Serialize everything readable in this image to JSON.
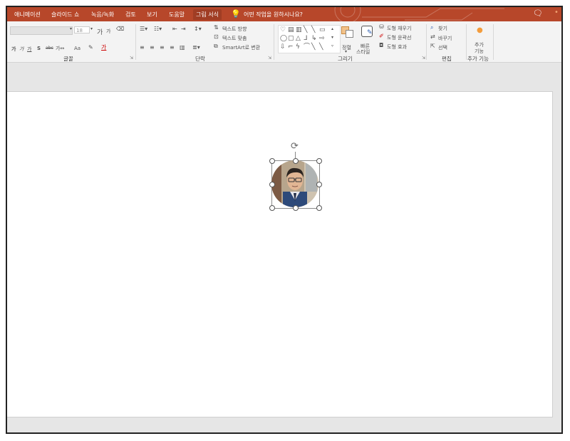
{
  "tabs": {
    "animations": "애니메이션",
    "slideshow": "슬라이드 쇼",
    "recording": "녹음/녹화",
    "review": "검토",
    "view": "보기",
    "help": "도움말",
    "picture_format": "그림 서식",
    "tell_me": "어떤 작업을 원하시나요?"
  },
  "ribbon": {
    "font": {
      "size": "18",
      "group_label": "글꼴",
      "bold": "가",
      "italic": "가",
      "underline": "가",
      "strike": "S",
      "abc": "abc",
      "spacing": "가↔",
      "case": "Aa",
      "grow": "가",
      "shrink": "가"
    },
    "paragraph": {
      "group_label": "단락",
      "text_direction": "텍스트 방향",
      "align_text": "텍스트 맞춤",
      "smartart": "SmartArt로 변환"
    },
    "drawing": {
      "group_label": "그리기",
      "arrange": "정렬",
      "quick_styles_1": "빠른",
      "quick_styles_2": "스타일",
      "shape_fill": "도형 채우기",
      "shape_outline": "도형 윤곽선",
      "shape_effects": "도형 효과"
    },
    "editing": {
      "group_label": "편집",
      "find": "찾기",
      "replace": "바꾸기",
      "select": "선택"
    },
    "addins": {
      "group_label": "추가 기능",
      "button_1": "추가",
      "button_2": "기능"
    }
  },
  "colors": {
    "accent": "#b7472a",
    "ribbon_bg": "#f3f3f3",
    "workspace_bg": "#e6e6e6",
    "slide_bg": "#ffffff"
  }
}
